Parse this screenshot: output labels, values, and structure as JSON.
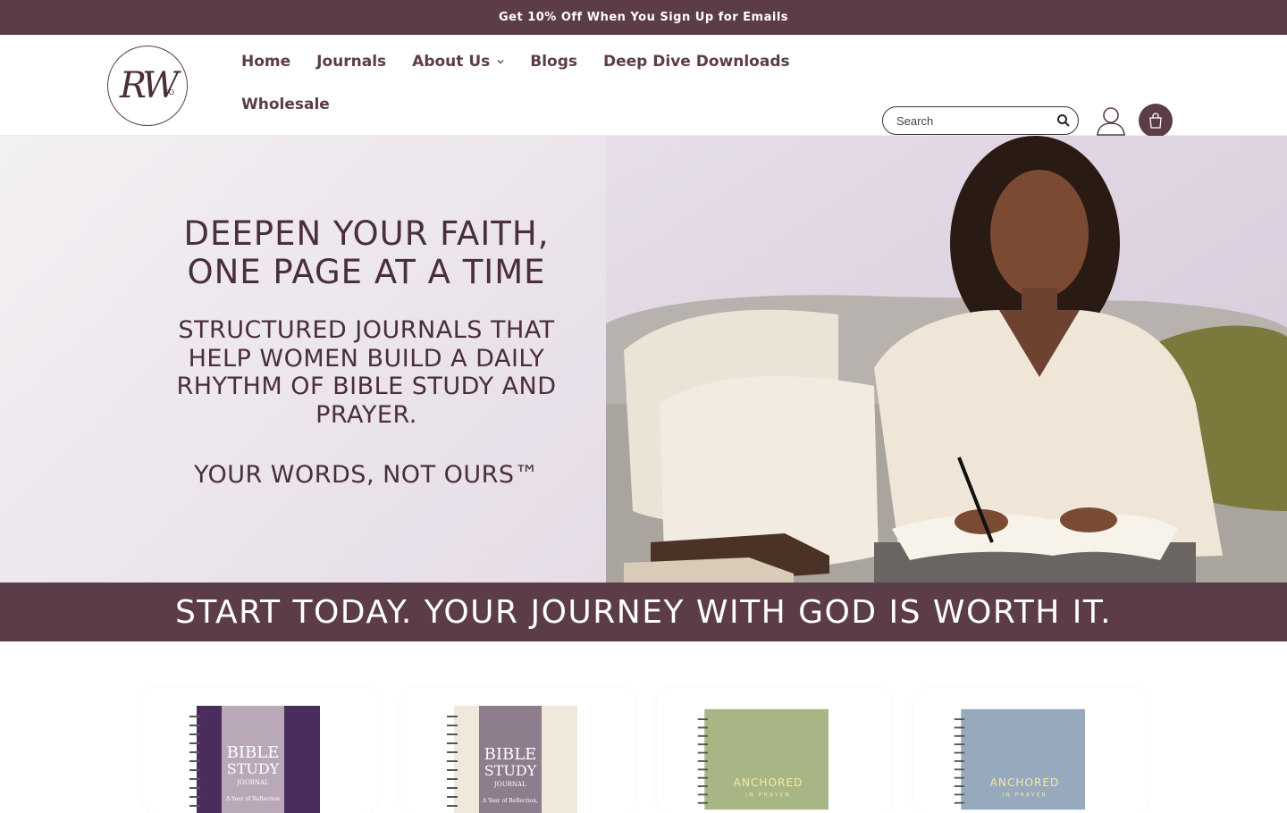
{
  "announcement": "Get 10% Off When You Sign Up for Emails",
  "logo": {
    "mark": "RW",
    "suffix": "CO"
  },
  "nav": {
    "items": [
      {
        "label": "Home"
      },
      {
        "label": "Journals"
      },
      {
        "label": "About Us",
        "has_dropdown": true
      },
      {
        "label": "Blogs"
      },
      {
        "label": "Deep Dive Downloads"
      },
      {
        "label": "Wholesale"
      }
    ]
  },
  "search": {
    "placeholder": "Search"
  },
  "icons": {
    "search": "search-icon",
    "account": "account-icon",
    "cart": "cart-icon"
  },
  "hero": {
    "title_line1": "DEEPEN YOUR FAITH,",
    "title_line2": "ONE PAGE AT A TIME",
    "subtitle": "STRUCTURED JOURNALS THAT HELP WOMEN BUILD A DAILY RHYTHM OF BIBLE STUDY AND PRAYER.",
    "tagline": "YOUR WORDS, NOT OURS™"
  },
  "banner": "START TODAY. YOUR JOURNEY WITH GOD IS WORTH IT.",
  "products": [
    {
      "cover_title": "BIBLE",
      "cover_title2": "STUDY",
      "cover_sub": "JOURNAL",
      "cover_note": "A Year of Reflection",
      "cover_color": "#4a2d5c"
    },
    {
      "cover_title": "BIBLE",
      "cover_title2": "STUDY",
      "cover_sub": "JOURNAL",
      "cover_note": "A Year of Reflection,",
      "cover_color": "#efe9dc"
    },
    {
      "cover_title": "ANCHORED",
      "cover_title2": "IN PRAYER",
      "cover_color": "#a7b684"
    },
    {
      "cover_title": "ANCHORED",
      "cover_title2": "IN PRAYER",
      "cover_color": "#97a9bd"
    }
  ],
  "colors": {
    "brand": "#5c3c48",
    "hero_text": "#4a2e3a"
  }
}
